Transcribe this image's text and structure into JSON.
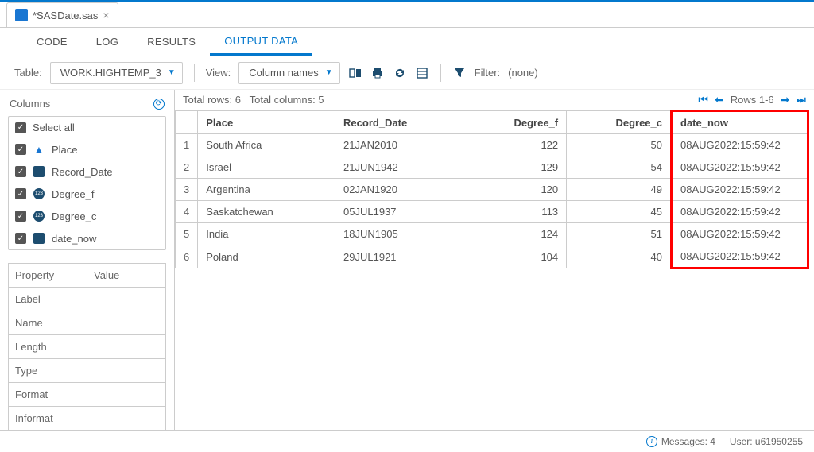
{
  "fileTab": {
    "name": "*SASDate.sas"
  },
  "tabs": {
    "code": "CODE",
    "log": "LOG",
    "results": "RESULTS",
    "output": "OUTPUT DATA"
  },
  "toolbar": {
    "tableLabel": "Table:",
    "tableValue": "WORK.HIGHTEMP_3",
    "viewLabel": "View:",
    "viewValue": "Column names",
    "filterLabel": "Filter:",
    "filterValue": "(none)"
  },
  "sidebar": {
    "columnsLabel": "Columns",
    "selectAll": "Select all",
    "cols": [
      {
        "label": "Place",
        "type": "char"
      },
      {
        "label": "Record_Date",
        "type": "date"
      },
      {
        "label": "Degree_f",
        "type": "num"
      },
      {
        "label": "Degree_c",
        "type": "num"
      },
      {
        "label": "date_now",
        "type": "date"
      }
    ]
  },
  "properties": {
    "headers": {
      "prop": "Property",
      "val": "Value"
    },
    "rows": [
      "Label",
      "Name",
      "Length",
      "Type",
      "Format",
      "Informat"
    ]
  },
  "grid": {
    "totalRows": "Total rows: 6",
    "totalCols": "Total columns: 5",
    "rowsRange": "Rows 1-6",
    "headers": {
      "place": "Place",
      "record_date": "Record_Date",
      "degree_f": "Degree_f",
      "degree_c": "Degree_c",
      "date_now": "date_now"
    },
    "data": [
      {
        "n": "1",
        "place": "South Africa",
        "rdate": "21JAN2010",
        "f": "122",
        "c": "50",
        "now": "08AUG2022:15:59:42"
      },
      {
        "n": "2",
        "place": "Israel",
        "rdate": "21JUN1942",
        "f": "129",
        "c": "54",
        "now": "08AUG2022:15:59:42"
      },
      {
        "n": "3",
        "place": "Argentina",
        "rdate": "02JAN1920",
        "f": "120",
        "c": "49",
        "now": "08AUG2022:15:59:42"
      },
      {
        "n": "4",
        "place": "Saskatchewan",
        "rdate": "05JUL1937",
        "f": "113",
        "c": "45",
        "now": "08AUG2022:15:59:42"
      },
      {
        "n": "5",
        "place": "India",
        "rdate": "18JUN1905",
        "f": "124",
        "c": "51",
        "now": "08AUG2022:15:59:42"
      },
      {
        "n": "6",
        "place": "Poland",
        "rdate": "29JUL1921",
        "f": "104",
        "c": "40",
        "now": "08AUG2022:15:59:42"
      }
    ]
  },
  "status": {
    "messages": "Messages: 4",
    "user": "User: u61950255"
  }
}
